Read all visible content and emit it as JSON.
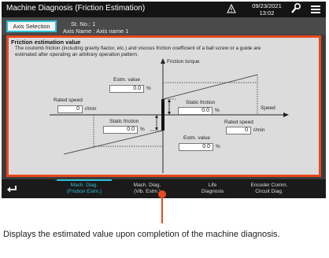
{
  "window": {
    "title": "Machine Diagnosis (Friction Estimation)",
    "warning_icon": "warning-icon",
    "date": "09/23/2021",
    "time": "13:02",
    "wrench_icon": "wrench-icon",
    "menu_icon": "menu-icon"
  },
  "axis": {
    "button_label": "Axis Selection",
    "st_no": "St. No.:   1",
    "axis_name": "Axis Name : Axis name 1"
  },
  "panel": {
    "title": "Friction estimation value",
    "description": "The coulomb friction (including gravity flactor, etc.) and viscous friction coefficient of a ball screw or a guide are estimated after operating an arbitrary operation pattern.",
    "friction_torque_label": "Friction torque",
    "speed_label": "Speed",
    "estm_value_top_label": "Estm. value",
    "estm_value_top": "0.0",
    "estm_value_top_unit": "%",
    "rated_speed_left_label": "Rated speed",
    "rated_speed_left": "0",
    "rated_speed_left_unit": "r/min",
    "static_friction_right_label": "Static friction",
    "static_friction_right": "0.0",
    "static_friction_right_unit": "%",
    "static_friction_left_label": "Static friction",
    "static_friction_left": "0.0",
    "static_friction_left_unit": "%",
    "rated_speed_right_label": "Rated speed",
    "rated_speed_right": "0",
    "rated_speed_right_unit": "r/min",
    "estm_value_bottom_label": "Estm. value",
    "estm_value_bottom": "0.0",
    "estm_value_bottom_unit": "%"
  },
  "tabs": [
    {
      "line1": "Mach. Diag.",
      "line2": "(Friction Estm.)",
      "active": true
    },
    {
      "line1": "Mach. Diag.",
      "line2": "(Vib. Estm.)",
      "active": false
    },
    {
      "line1": "Life",
      "line2": "Diagnosis",
      "active": false
    },
    {
      "line1": "Encoder Comm.",
      "line2": "Circuit Diag.",
      "active": false
    }
  ],
  "back_icon": "back-icon",
  "caption": "Displays the estimated value upon completion of the machine diagnosis.",
  "colors": {
    "accent_cyan": "#2fbfd6",
    "highlight_orange": "#e8491d"
  }
}
